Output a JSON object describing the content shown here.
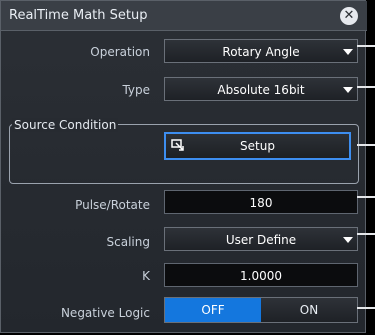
{
  "window": {
    "title": "RealTime Math Setup"
  },
  "fields": {
    "operation": {
      "label": "Operation",
      "value": "Rotary Angle"
    },
    "type": {
      "label": "Type",
      "value": "Absolute 16bit"
    },
    "source_condition": {
      "label": "Source Condition",
      "button": "Setup"
    },
    "pulse_rotate": {
      "label": "Pulse/Rotate",
      "value": "180"
    },
    "scaling": {
      "label": "Scaling",
      "value": "User Define"
    },
    "k": {
      "label": "K",
      "value": "1.0000"
    },
    "negative_logic": {
      "label": "Negative Logic",
      "off": "OFF",
      "on": "ON",
      "selected": "OFF"
    }
  },
  "colors": {
    "accent": "#1477de",
    "panel_bg": "#23272d",
    "field_bg": "#0b0c0e"
  },
  "icons": {
    "close": "close-icon",
    "setup": "setup-icon",
    "dropdown": "chevron-down-icon"
  }
}
